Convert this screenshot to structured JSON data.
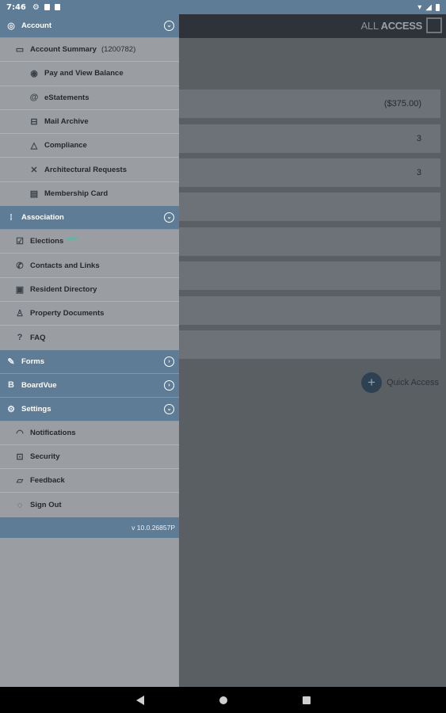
{
  "status": {
    "time": "7:46"
  },
  "background": {
    "brand_light": "ALL",
    "brand_bold": "ACCESS",
    "rows": [
      "($375.00)",
      "3",
      "3",
      "",
      "",
      "",
      "",
      ""
    ],
    "quick_access": "Quick Access",
    "quick_access_icon": "+"
  },
  "drawer": {
    "account": {
      "label": "Account",
      "summary_label": "Account Summary",
      "summary_number": "(1200782)",
      "items": [
        "Pay and View Balance",
        "eStatements",
        "Mail Archive",
        "Compliance",
        "Architectural Requests",
        "Membership Card"
      ]
    },
    "association": {
      "label": "Association",
      "elections_label": "Elections",
      "elections_badge": "active",
      "items": [
        "Contacts and Links",
        "Resident Directory",
        "Property Documents",
        "FAQ"
      ]
    },
    "forms": {
      "label": "Forms"
    },
    "boardvue": {
      "label": "BoardVue"
    },
    "settings": {
      "label": "Settings",
      "items": [
        "Notifications",
        "Security",
        "Feedback",
        "Sign Out"
      ]
    },
    "version": "v 10.0.26857P"
  },
  "colors": {
    "header_blue": "#5e7c96",
    "drawer_bg": "#9a9ea2",
    "badge_green": "#2fc9a0"
  }
}
